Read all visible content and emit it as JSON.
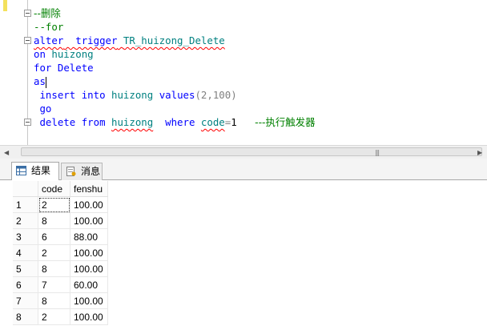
{
  "editor": {
    "lines": [
      {
        "parts": [
          {
            "t": "--删除",
            "c": "cm cjkc"
          }
        ]
      },
      {
        "parts": [
          {
            "t": "--for",
            "c": "cm"
          }
        ]
      },
      {
        "parts": [
          {
            "t": "alter",
            "c": "kw sq"
          },
          {
            "t": "  ",
            "c": "sq"
          },
          {
            "t": "trigger",
            "c": "kw sq"
          },
          {
            "t": " ",
            "c": "sq"
          },
          {
            "t": "TR_huizong_Delete",
            "c": "tb sq"
          }
        ]
      },
      {
        "parts": [
          {
            "t": "on",
            "c": "kw"
          },
          {
            "t": " "
          },
          {
            "t": "huizong",
            "c": "tb"
          }
        ]
      },
      {
        "parts": [
          {
            "t": "for",
            "c": "kw"
          },
          {
            "t": " "
          },
          {
            "t": "Delete",
            "c": "kw"
          }
        ]
      },
      {
        "parts": [
          {
            "t": "as",
            "c": "kw"
          }
        ]
      },
      {
        "parts": [
          {
            "t": " insert",
            "c": "kw"
          },
          {
            "t": " "
          },
          {
            "t": "into",
            "c": "kw"
          },
          {
            "t": " "
          },
          {
            "t": "huizong",
            "c": "tb"
          },
          {
            "t": " "
          },
          {
            "t": "values",
            "c": "kw"
          },
          {
            "t": "(2,100)",
            "c": "gr"
          }
        ]
      },
      {
        "parts": [
          {
            "t": " go",
            "c": "kw"
          }
        ]
      },
      {
        "parts": [
          {
            "t": " delete",
            "c": "kw"
          },
          {
            "t": " "
          },
          {
            "t": "from",
            "c": "kw"
          },
          {
            "t": " "
          },
          {
            "t": "huizong",
            "c": "tb sq"
          },
          {
            "t": "  "
          },
          {
            "t": "where",
            "c": "kw"
          },
          {
            "t": " "
          },
          {
            "t": "code",
            "c": "tb sq"
          },
          {
            "t": "=",
            "c": "gr"
          },
          {
            "t": "1"
          },
          {
            "t": "   "
          },
          {
            "t": "---执行触发器",
            "c": "cm cjkc"
          }
        ]
      }
    ]
  },
  "tabs": {
    "results_label": "结果",
    "messages_label": "消息"
  },
  "grid": {
    "columns": [
      "code",
      "fenshu"
    ],
    "rows": [
      {
        "n": "1",
        "code": "2",
        "fenshu": "100.00"
      },
      {
        "n": "2",
        "code": "8",
        "fenshu": "100.00"
      },
      {
        "n": "3",
        "code": "6",
        "fenshu": "88.00"
      },
      {
        "n": "4",
        "code": "2",
        "fenshu": "100.00"
      },
      {
        "n": "5",
        "code": "8",
        "fenshu": "100.00"
      },
      {
        "n": "6",
        "code": "7",
        "fenshu": "60.00"
      },
      {
        "n": "7",
        "code": "8",
        "fenshu": "100.00"
      },
      {
        "n": "8",
        "code": "2",
        "fenshu": "100.00"
      }
    ]
  },
  "scrollbar": {
    "left_icon": "arrow-left-icon",
    "right_icon": "arrow-right-icon",
    "grip": "|||"
  }
}
